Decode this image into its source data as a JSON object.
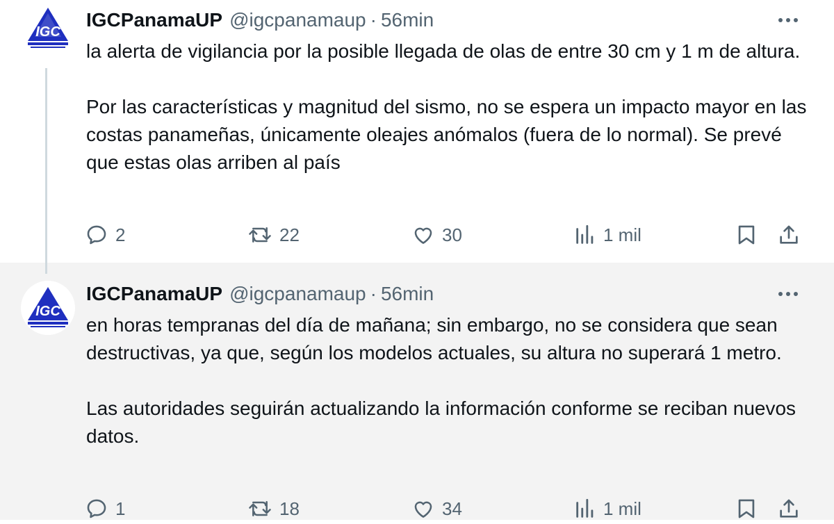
{
  "tweets": [
    {
      "display_name": "IGCPanamaUP",
      "handle": "@igcpanamaup",
      "separator": "·",
      "time": "56min",
      "paragraphs": [
        "la alerta de vigilancia por la posible llegada de olas de entre 30 cm y 1 m de altura.",
        "Por las características y magnitud del sismo, no se espera un impacto mayor en las costas panameñas, únicamente oleajes anómalos (fuera de lo normal). Se prevé que estas olas arriben al país"
      ],
      "replies": "2",
      "reposts": "22",
      "likes": "30",
      "views": "1 mil"
    },
    {
      "display_name": "IGCPanamaUP",
      "handle": "@igcpanamaup",
      "separator": "·",
      "time": "56min",
      "paragraphs": [
        "en horas tempranas del día de mañana; sin embargo, no se considera que sean destructivas, ya que, según los modelos actuales, su altura no superará 1 metro.",
        "Las autoridades seguirán actualizando la información conforme se reciban nuevos datos."
      ],
      "replies": "1",
      "reposts": "18",
      "likes": "34",
      "views": "1 mil"
    }
  ],
  "avatar": {
    "logo_text": "IGC",
    "colors": {
      "logo_blue": "#1f2fbf"
    }
  },
  "icons": {
    "reply": "speech-bubble-icon",
    "repost": "repost-arrows-icon",
    "like": "heart-icon",
    "views": "bar-chart-icon",
    "bookmark": "bookmark-icon",
    "share": "share-upload-icon",
    "more": "ellipsis-icon"
  },
  "colors": {
    "text_primary": "#0f1419",
    "text_secondary": "#536471",
    "thread_line": "#cfd9de",
    "hover_bg": "#f3f3f3"
  }
}
